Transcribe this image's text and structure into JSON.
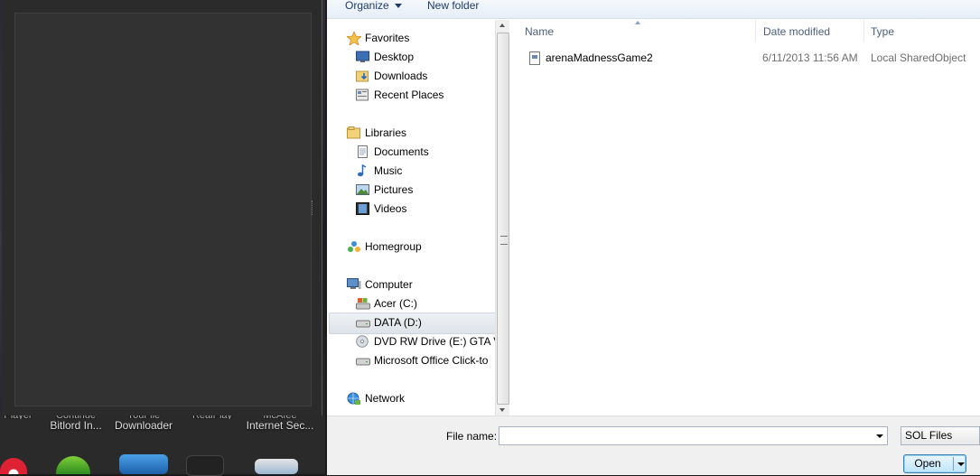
{
  "desktop": {
    "labels": [
      {
        "top": "Player",
        "bottom": ""
      },
      {
        "top": "Continue",
        "bottom": "Bitlord In..."
      },
      {
        "top": "YouFile",
        "bottom": "Downloader"
      },
      {
        "top": "RealPlay",
        "bottom": ""
      },
      {
        "top": "McAfee",
        "bottom": "Internet Sec..."
      }
    ]
  },
  "toolbar": {
    "organize_label": "Organize",
    "new_folder_label": "New folder"
  },
  "nav": {
    "favorites": "Favorites",
    "desktop": "Desktop",
    "downloads": "Downloads",
    "recent_places": "Recent Places",
    "libraries": "Libraries",
    "documents": "Documents",
    "music": "Music",
    "pictures": "Pictures",
    "videos": "Videos",
    "homegroup": "Homegroup",
    "computer": "Computer",
    "acer_c": "Acer (C:)",
    "data_d": "DATA (D:)",
    "dvd_e": "DVD RW Drive (E:) GTA V",
    "office": "Microsoft Office Click-to",
    "network": "Network"
  },
  "columns": {
    "name": "Name",
    "date_modified": "Date modified",
    "type": "Type"
  },
  "files": [
    {
      "name": "arenaMadnessGame2",
      "date": "6/11/2013 11:56 AM",
      "type": "Local SharedObject"
    }
  ],
  "bottom": {
    "file_name_label": "File name:",
    "file_name_value": "",
    "filter_value": "SOL Files",
    "open_label": "Open"
  }
}
